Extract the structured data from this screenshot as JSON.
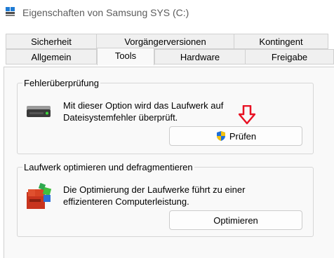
{
  "window": {
    "title": "Eigenschaften von Samsung SYS (C:)",
    "app_icon": "drive-window-icon"
  },
  "tabs": {
    "row1": [
      {
        "label": "Sicherheit"
      },
      {
        "label": "Vorgängerversionen"
      },
      {
        "label": "Kontingent"
      }
    ],
    "row2": [
      {
        "label": "Allgemein"
      },
      {
        "label": "Tools",
        "active": true
      },
      {
        "label": "Hardware"
      },
      {
        "label": "Freigabe"
      }
    ]
  },
  "error_check": {
    "legend": "Fehlerüberprüfung",
    "desc_line1": "Mit dieser Option wird das Laufwerk auf",
    "desc_line2": "Dateisystemfehler überprüft.",
    "button_label": "Prüfen",
    "icon": "hard-drive-icon",
    "button_icon": "uac-shield-icon"
  },
  "optimize": {
    "legend": "Laufwerk optimieren und defragmentieren",
    "desc_line1": "Die Optimierung der Laufwerke führt zu einer",
    "desc_line2": "effizienteren Computerleistung.",
    "button_label": "Optimieren",
    "icon": "defrag-icon"
  },
  "annotation": {
    "icon": "red-down-arrow-icon",
    "color": "#e81123"
  }
}
